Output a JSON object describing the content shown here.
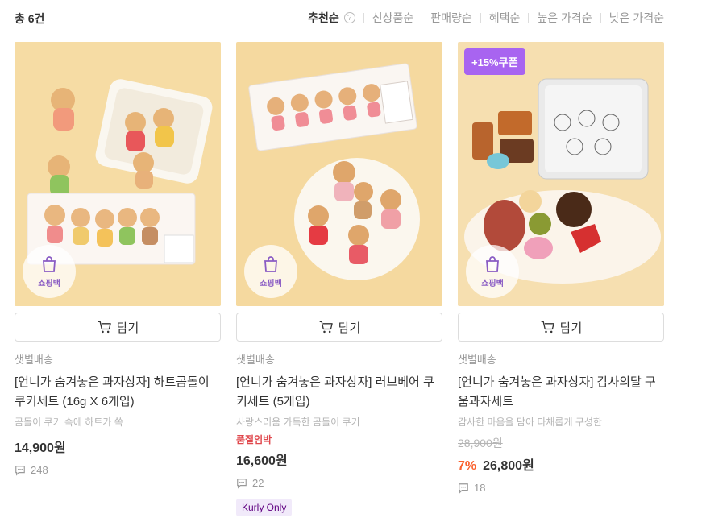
{
  "header": {
    "total": "총 6건",
    "sorts": [
      "추천순",
      "신상품순",
      "판매량순",
      "혜택순",
      "높은 가격순",
      "낮은 가격순"
    ],
    "active_sort": "추천순"
  },
  "common": {
    "cart_label": "담기",
    "bag_label": "쇼핑백",
    "delivery": "샛별배송"
  },
  "products": [
    {
      "title": "[언니가 숨겨놓은 과자상자] 하트곰돌이 쿠키세트 (16g X 6개입)",
      "desc": "곰돌이 쿠키 속에 하트가 쏙",
      "price": "14,900원",
      "reviews": "248",
      "image_label": "언니가 숨겨놓은 과자상자"
    },
    {
      "title": "[언니가 숨겨놓은 과자상자] 러브베어 쿠키세트 (5개입)",
      "desc": "사랑스러움 가득한 곰돌이 쿠키",
      "status": "품절임박",
      "price": "16,600원",
      "reviews": "22",
      "badge": "Kurly Only"
    },
    {
      "coupon": "+15%쿠폰",
      "title": "[언니가 숨겨놓은 과자상자] 감사의달 구움과자세트",
      "desc": "감사한 마음을 담아 다채롭게 구성한",
      "original_price": "28,900원",
      "discount": "7%",
      "price": "26,800원",
      "reviews": "18",
      "image_label": "언니가 숨겨놓은 과자상자"
    }
  ],
  "colors": {
    "accent": "#5f0080",
    "coupon": "#a864f0",
    "discount": "#fa622f",
    "soldout": "#e0494e"
  }
}
